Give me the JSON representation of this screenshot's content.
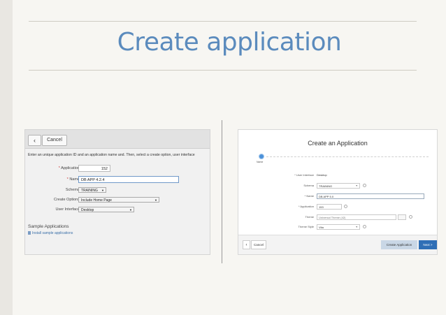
{
  "slide": {
    "title": "Create application"
  },
  "left_screenshot": {
    "back_label": "‹",
    "cancel_label": "Cancel",
    "instruction": "Enter an unique application ID and an application name and. Then, select a create option, user interface",
    "fields": {
      "application": {
        "label": "Application",
        "required_mark": "*",
        "value": "152"
      },
      "name": {
        "label": "Name",
        "required_mark": "*",
        "value": "DB APP 4.2.4"
      },
      "schema": {
        "label": "Schema",
        "value": "TRAINING"
      },
      "create_options": {
        "label": "Create Options",
        "value": "Include Home Page"
      },
      "user_interface": {
        "label": "User Interface",
        "value": "Desktop"
      }
    },
    "sample_heading": "Sample Applications",
    "sample_link": "Install sample applications"
  },
  "right_screenshot": {
    "title": "Create an Application",
    "step_label": "Name",
    "fields": {
      "user_interface": {
        "label": "* User Interface",
        "value": "Desktop"
      },
      "schema": {
        "label": "Schema",
        "value": "TRAINING"
      },
      "name": {
        "label": "* Name",
        "value": "DB APP 5.0"
      },
      "application": {
        "label": "* Application",
        "value": "153"
      },
      "theme": {
        "label": "Theme",
        "value": "Universal Theme (42)"
      },
      "theme_style": {
        "label": "Theme Style",
        "value": "Vita"
      }
    },
    "back_label": "‹",
    "cancel_label": "Cancel",
    "create_label": "Create Application",
    "next_label": "Next >"
  },
  "colors": {
    "title": "#5b8bbd",
    "next_button": "#2f6fb6",
    "step_dot": "#4a90d9"
  }
}
